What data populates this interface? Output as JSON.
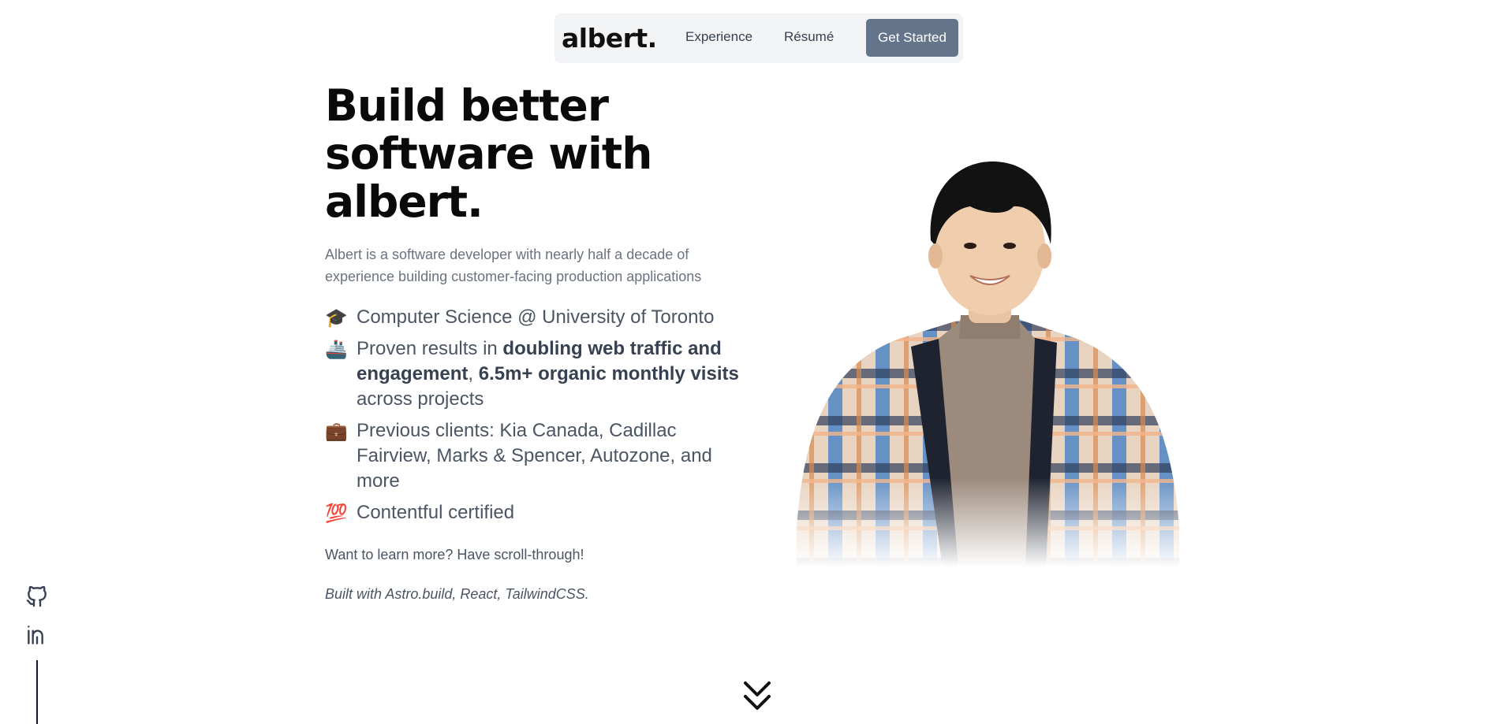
{
  "nav": {
    "logo": "albert.",
    "experience": "Experience",
    "resume": "Résumé",
    "cta": "Get Started"
  },
  "hero": {
    "title_line1": "Build better",
    "title_line2": "software with",
    "title_line3": "albert.",
    "subtitle": "Albert is a software developer with nearly half a decade of experience building customer-facing production applications",
    "features": [
      {
        "emoji": "🎓",
        "text": "Computer Science @ University of Toronto"
      },
      {
        "emoji": "🚢",
        "pre": "Proven results in ",
        "bold1": "doubling web traffic and engagement",
        "mid": ", ",
        "bold2": "6.5m+ organic monthly visits",
        "post": " across projects"
      },
      {
        "emoji": "💼",
        "text": "Previous clients: Kia Canada, Cadillac Fairview, Marks & Spencer, Autozone, and more"
      },
      {
        "emoji": "💯",
        "text": "Contentful certified"
      }
    ],
    "learn_more": "Want to learn more? Have scroll-through!",
    "built_with": "Built with Astro.build, React, TailwindCSS."
  },
  "social": {
    "github_icon": "github-icon",
    "linkedin_icon": "linkedin-icon"
  },
  "colors": {
    "cta_bg": "#64748b",
    "nav_bg": "#f3f4f6",
    "text": "#4b5563",
    "heading": "#0a0a0a"
  }
}
